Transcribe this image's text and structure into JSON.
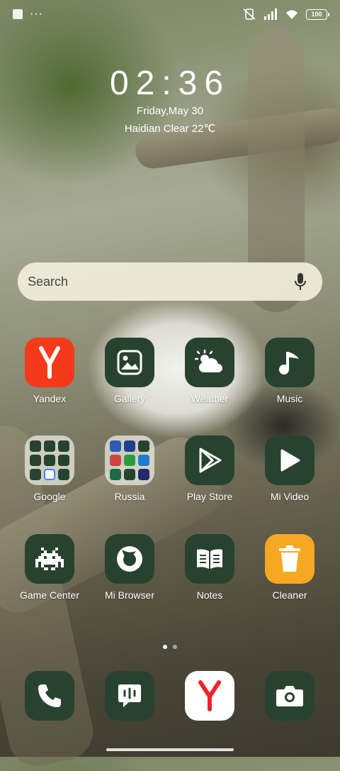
{
  "status_bar": {
    "battery": "100"
  },
  "lock": {
    "time": "02:36",
    "date": "Friday,May 30",
    "weather": "Haidian Clear 22℃"
  },
  "search": {
    "placeholder": "Search"
  },
  "apps": [
    {
      "label": "Yandex",
      "icon": "yandex-icon",
      "color": "#f5391b"
    },
    {
      "label": "Gallery",
      "icon": "gallery-icon"
    },
    {
      "label": "Weather",
      "icon": "weather-icon"
    },
    {
      "label": "Music",
      "icon": "music-icon"
    },
    {
      "label": "Google",
      "icon": "folder-icon"
    },
    {
      "label": "Russia",
      "icon": "folder-icon"
    },
    {
      "label": "Play Store",
      "icon": "play-store-icon"
    },
    {
      "label": "Mi Video",
      "icon": "mi-video-icon"
    },
    {
      "label": "Game Center",
      "icon": "game-center-icon"
    },
    {
      "label": "Mi Browser",
      "icon": "browser-icon"
    },
    {
      "label": "Notes",
      "icon": "notes-icon"
    },
    {
      "label": "Cleaner",
      "icon": "cleaner-icon",
      "color": "#f7a823"
    }
  ],
  "dock": [
    {
      "icon": "phone-icon"
    },
    {
      "icon": "messages-icon"
    },
    {
      "icon": "yandex-browser-icon"
    },
    {
      "icon": "camera-icon"
    }
  ],
  "colors": {
    "icon_bg": "#27432f",
    "yandex": "#f5391b",
    "cleaner": "#f7a823"
  }
}
